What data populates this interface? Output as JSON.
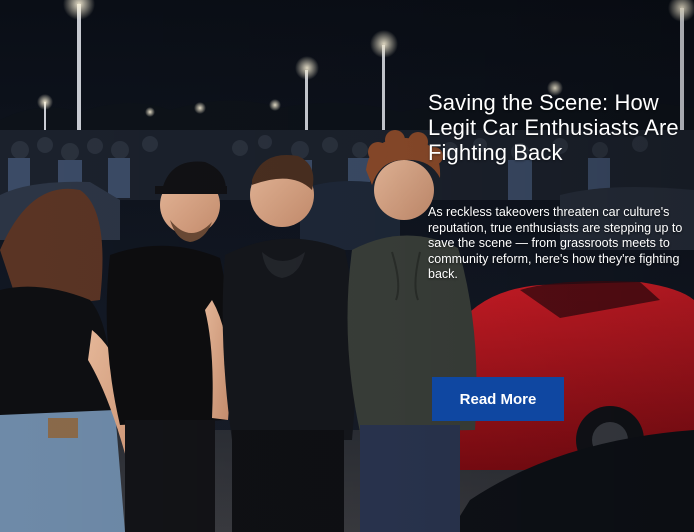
{
  "article": {
    "headline": "Saving the Scene: How Legit Car Enthusiasts Are Fighting Back",
    "summary": "As reckless takeovers threaten car culture's reputation, true enthusiasts are stepping up to save the scene — from grassroots meets to community reform, here's how they're fighting back.",
    "read_more_label": "Read More"
  },
  "colors": {
    "button_background": "#0f47a1",
    "text": "#ffffff",
    "sky": "#0b0f16",
    "car_red": "#b5131c"
  }
}
